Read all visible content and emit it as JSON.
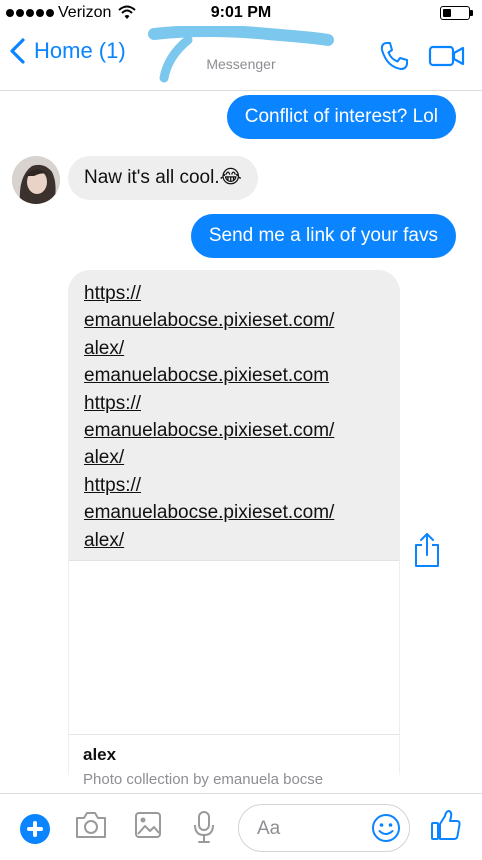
{
  "status_bar": {
    "carrier": "Verizon",
    "time": "9:01 PM",
    "battery_level": 0.35
  },
  "nav": {
    "back_label": "Home (1)",
    "subtitle": "Messenger"
  },
  "messages": [
    {
      "direction": "outgoing",
      "text": "Conflict of interest? Lol"
    },
    {
      "direction": "incoming",
      "text": "Naw it's all cool.😂"
    },
    {
      "direction": "outgoing",
      "text": "Send me a link of your favs"
    }
  ],
  "link_message": {
    "lines": [
      "https://",
      "emanuelabocse.pixieset.com/",
      "alex/",
      "emanuelabocse.pixieset.com",
      "https://",
      "emanuelabocse.pixieset.com/",
      "alex/",
      "https://",
      "emanuelabocse.pixieset.com/",
      "alex/"
    ],
    "preview_title": "alex",
    "preview_subtitle": "Photo collection by emanuela bocse"
  },
  "composer": {
    "placeholder": "Aa"
  },
  "icons": {
    "back": "chevron-left-icon",
    "call": "phone-icon",
    "video": "video-camera-icon",
    "share": "share-icon",
    "add": "plus-icon",
    "camera": "camera-icon",
    "gallery": "image-icon",
    "voice": "microphone-icon",
    "emoji": "smiley-icon",
    "like": "thumbs-up-icon"
  },
  "colors": {
    "accent": "#0a84ff",
    "incoming_bubble": "#eeeeee",
    "scribble": "#7cc7ee"
  }
}
